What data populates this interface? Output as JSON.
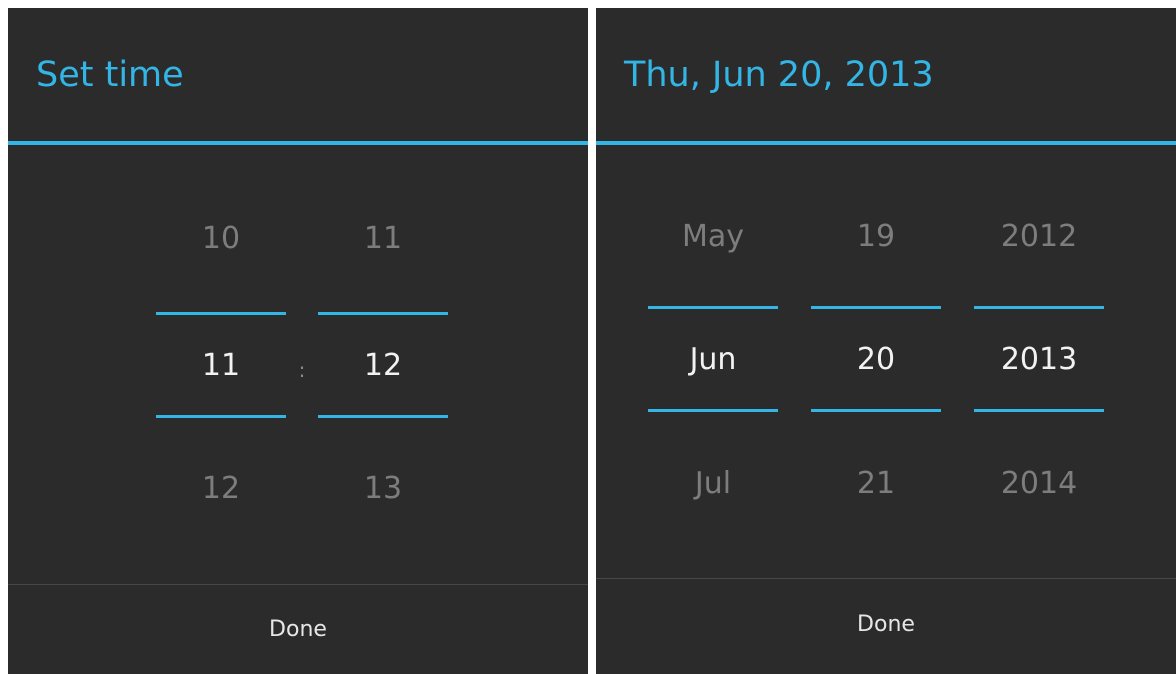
{
  "time_dialog": {
    "title": "Set time",
    "hour_column": {
      "prev": "10",
      "selected": "11",
      "next": "12"
    },
    "separator": ":",
    "minute_column": {
      "prev": "11",
      "selected": "12",
      "next": "13"
    },
    "done_label": "Done"
  },
  "date_dialog": {
    "title": "Thu, Jun 20, 2013",
    "month_column": {
      "prev": "May",
      "selected": "Jun",
      "next": "Jul"
    },
    "day_column": {
      "prev": "19",
      "selected": "20",
      "next": "21"
    },
    "year_column": {
      "prev": "2012",
      "selected": "2013",
      "next": "2014"
    },
    "done_label": "Done"
  },
  "colors": {
    "accent": "#33b5e5",
    "dialog_background": "#2b2b2b",
    "selected_text": "#f2f2f2",
    "unselected_text": "#7d7d7d"
  }
}
